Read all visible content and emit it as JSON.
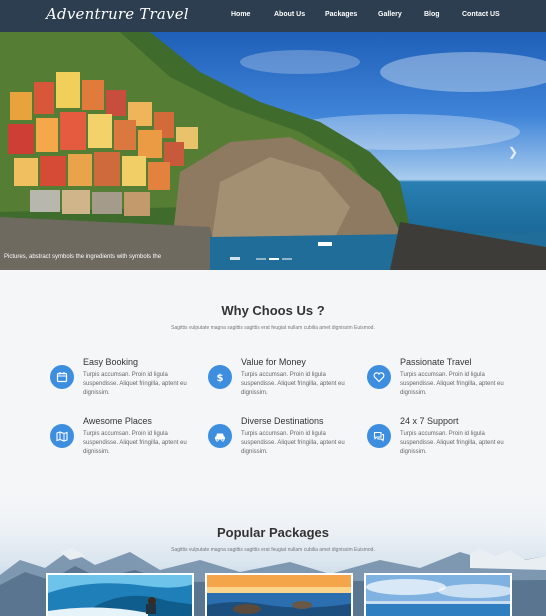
{
  "nav": {
    "logo": "Adventrure Travel",
    "items": [
      "Home",
      "About Us",
      "Packages",
      "Gallery",
      "Blog",
      "Contact US"
    ]
  },
  "hero": {
    "caption": "Pictures, abstract symbols the ingredients with symbols the",
    "next_icon": "chevron-right-icon",
    "slides": 3,
    "active_slide": 2
  },
  "why": {
    "title": "Why Choos Us ?",
    "subtitle": "Sagittis vulputate magna sagittis sagittis erat feugiat nullam cubilia amet dignissim Euismod.",
    "features": [
      {
        "title": "Easy Booking",
        "desc": "Turpis accumsan. Proin id ligula suspendisse. Aliquet fringilla, aptent eu dignissim.",
        "icon": "calendar-icon"
      },
      {
        "title": "Value for Money",
        "desc": "Turpis accumsan. Proin id ligula suspendisse. Aliquet fringilla, aptent eu dignissim.",
        "icon": "dollar-icon"
      },
      {
        "title": "Passionate Travel",
        "desc": "Turpis accumsan. Proin id ligula suspendisse. Aliquet fringilla, aptent eu dignissim.",
        "icon": "heart-icon"
      },
      {
        "title": "Awesome Places",
        "desc": "Turpis accumsan. Proin id ligula suspendisse. Aliquet fringilla, aptent eu dignissim.",
        "icon": "map-icon"
      },
      {
        "title": "Diverse Destinations",
        "desc": "Turpis accumsan. Proin id ligula suspendisse. Aliquet fringilla, aptent eu dignissim.",
        "icon": "car-icon"
      },
      {
        "title": "24 x 7 Support",
        "desc": "Turpis accumsan. Proin id ligula suspendisse. Aliquet fringilla, aptent eu dignissim.",
        "icon": "chat-icon"
      }
    ]
  },
  "popular": {
    "title": "Popular Packages",
    "subtitle": "Sagittis vulputate magna sagittis sagittis erat feugiat nullam cubilia amet dignissim Euismod."
  },
  "colors": {
    "nav_bg": "#2c3e50",
    "accent": "#3e8ee0"
  }
}
